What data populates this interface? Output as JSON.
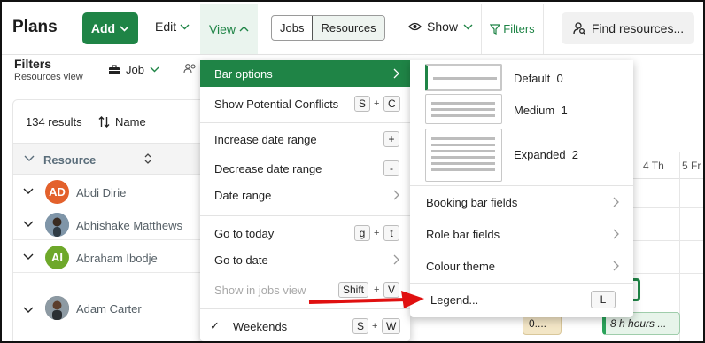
{
  "topbar": {
    "title": "Plans",
    "add_label": "Add",
    "edit_label": "Edit",
    "view_label": "View",
    "segment": [
      "Jobs",
      "Resources"
    ],
    "show_label": "Show",
    "filters_label": "Filters",
    "find_label": "Find resources..."
  },
  "filterbar": {
    "title": "Filters",
    "subtitle": "Resources view",
    "job_label": "Job"
  },
  "panel": {
    "results": "134 results",
    "sort_label": "Name",
    "column_header": "Resource",
    "rows": [
      {
        "name": "Abdi Dirie",
        "initials": "AD",
        "avatar_color": "#e3612c"
      },
      {
        "name": "Abhishake Matthews",
        "initials": "",
        "avatar_color": "#6b8aa3"
      },
      {
        "name": "Abraham Ibodje",
        "initials": "AI",
        "avatar_color": "#6ea82a"
      },
      {
        "name": "Adam Carter",
        "initials": "",
        "avatar_color": "#4f5a63"
      }
    ]
  },
  "timeline": {
    "days": [
      "4 Th",
      "5 Fr"
    ],
    "booking_text_1": "0....",
    "booking_text_2": "8 h hours ..."
  },
  "view_menu": {
    "items": [
      {
        "label": "Bar options"
      },
      {
        "label": "Show Potential Conflicts",
        "keys": [
          "S",
          "C"
        ]
      },
      {
        "label": "Increase date range",
        "keys": [
          "+"
        ]
      },
      {
        "label": "Decrease date range",
        "keys": [
          "-"
        ]
      },
      {
        "label": "Date range"
      },
      {
        "label": "Go to today",
        "keys": [
          "g",
          "t"
        ]
      },
      {
        "label": "Go to date"
      },
      {
        "label": "Show in jobs view",
        "keys": [
          "Shift",
          "V"
        ]
      },
      {
        "label": "Weekends",
        "keys": [
          "S",
          "W"
        ],
        "check": "✓"
      }
    ],
    "plus": "+"
  },
  "bar_options_menu": {
    "options": [
      {
        "label": "Default",
        "key": "0"
      },
      {
        "label": "Medium",
        "key": "1"
      },
      {
        "label": "Expanded",
        "key": "2"
      }
    ],
    "items": [
      {
        "label": "Booking bar fields"
      },
      {
        "label": "Role bar fields"
      },
      {
        "label": "Colour theme"
      },
      {
        "label": "Legend...",
        "key": "L"
      }
    ]
  },
  "colors": {
    "brand_green": "#1f8446",
    "annotation_red": "#e01010"
  }
}
